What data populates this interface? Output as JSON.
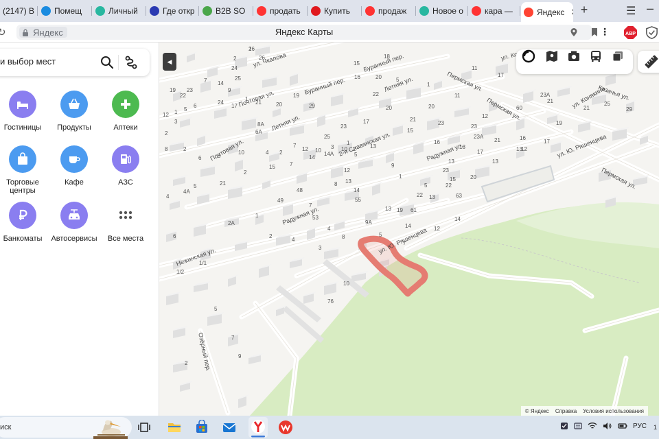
{
  "browser": {
    "tabs": [
      {
        "label": "(2147) В",
        "icon": "vk-icon",
        "color": "#8d9aa8"
      },
      {
        "label": "Помещ",
        "icon": "cian-icon",
        "color": "#1a8be0"
      },
      {
        "label": "Личный",
        "icon": "domclick-icon",
        "color": "#28b7a0"
      },
      {
        "label": "Где откр",
        "icon": "ring-icon",
        "color": "#2a3ab2"
      },
      {
        "label": "B2B SO",
        "icon": "b2b-icon",
        "color": "#4aa64a"
      },
      {
        "label": "продать",
        "icon": "yandex-icon",
        "color": "#f33"
      },
      {
        "label": "Купить",
        "icon": "avito-red-icon",
        "color": "#e0191e"
      },
      {
        "label": "продаж",
        "icon": "yandex-icon",
        "color": "#f33"
      },
      {
        "label": "Новое о",
        "icon": "domclick-icon",
        "color": "#28b7a0"
      },
      {
        "label": "кара — ",
        "icon": "yandex-icon",
        "color": "#f33"
      },
      {
        "label": "Яндекс",
        "icon": "yandex-maps-icon",
        "color": "#f43",
        "active": true
      }
    ],
    "address": {
      "site": "Яндекс",
      "title": "Яндекс Карты"
    },
    "abp_label": "ABP"
  },
  "search": {
    "placeholder": "и выбор мест"
  },
  "categories": [
    {
      "label": "Гостиницы",
      "icon": "bed-icon",
      "color": "#8a7ef0"
    },
    {
      "label": "Продукты",
      "icon": "basket-icon",
      "color": "#4c9bf0"
    },
    {
      "label": "Аптеки",
      "icon": "cross-icon",
      "color": "#4dba50"
    },
    {
      "label": "Торговые центры",
      "icon": "shopping-bag-icon",
      "color": "#4c9bf0"
    },
    {
      "label": "Кафе",
      "icon": "cup-icon",
      "color": "#4c9bf0"
    },
    {
      "label": "АЗС",
      "icon": "fuel-icon",
      "color": "#8a7ef0"
    },
    {
      "label": "Банкоматы",
      "icon": "ruble-icon",
      "color": "#8a7ef0"
    },
    {
      "label": "Автосервисы",
      "icon": "car-service-icon",
      "color": "#8a7ef0"
    },
    {
      "label": "Все места",
      "icon": "grid-dots-icon",
      "color": "#ffffff"
    }
  ],
  "map": {
    "streets": [
      "ул. Чкалова",
      "Почтовая ул.",
      "Почтовая ул.",
      "Летняя ул.",
      "Буранный пер.",
      "Буранный пер.",
      "Летняя ул.",
      "2-я Славянская ул.",
      "Пермская ул.",
      "Пермская ул.",
      "Радужная ул.",
      "Радужная ул.",
      "ул. Коня",
      "ул. Конякина",
      "Казачья ул.",
      "ул. Ю. Ряшенцева",
      "Пермская ул.",
      "ул. Ю. Ряшенцева",
      "Нежинская ул.",
      "Озёрный пер."
    ],
    "numbers": [
      "26",
      "2",
      "24",
      "25",
      "14",
      "7",
      "23",
      "22",
      "19",
      "12",
      "24",
      "17",
      "6",
      "5",
      "1",
      "3",
      "2",
      "26",
      "9",
      "1",
      "6А",
      "8А",
      "8",
      "2",
      "6",
      "3",
      "10",
      "4",
      "2",
      "7",
      "12",
      "10",
      "3",
      "1",
      "4",
      "4А",
      "5",
      "21",
      "2",
      "15",
      "7",
      "14",
      "14А",
      "10",
      "2",
      "13",
      "8",
      "48",
      "49",
      "7",
      "55",
      "53",
      "4",
      "8",
      "9А",
      "5",
      "7",
      "3",
      "12",
      "14",
      "13",
      "6",
      "2А",
      "1",
      "2",
      "4",
      "10",
      "76",
      "1/1",
      "1/2",
      "5",
      "7",
      "9",
      "2",
      "29",
      "25",
      "21",
      "19",
      "17",
      "13",
      "12",
      "11",
      "1",
      "5",
      "20",
      "16",
      "20",
      "22",
      "20",
      "21",
      "23",
      "23",
      "18",
      "17",
      "23А",
      "21",
      "15",
      "16",
      "13",
      "23",
      "5",
      "1",
      "9",
      "5",
      "12",
      "13",
      "14",
      "15",
      "63",
      "61",
      "60",
      "21",
      "23А",
      "11",
      "17",
      "16",
      "12",
      "13",
      "20",
      "22",
      "22",
      "19",
      "14",
      "13",
      "17",
      "23",
      "25",
      "29",
      "20",
      "21",
      "19",
      "15",
      "18",
      "17",
      "1"
    ],
    "attribution": [
      "© Яндекс",
      "Справка",
      "Условия использования"
    ]
  },
  "taskbar": {
    "search_text": "иск",
    "language": "РУС",
    "clock": "1"
  }
}
